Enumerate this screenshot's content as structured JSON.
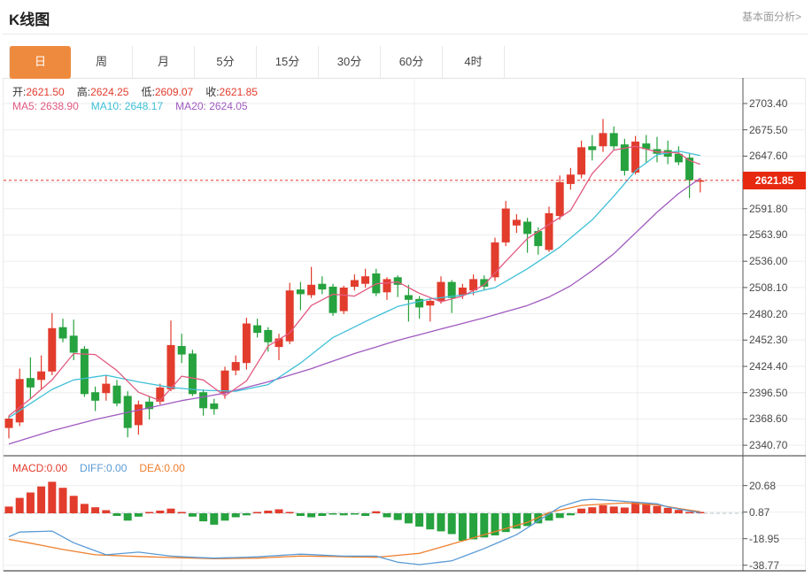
{
  "header": {
    "title": "K线图",
    "link": "基本面分析>"
  },
  "tabs": {
    "items": [
      "日",
      "周",
      "月",
      "5分",
      "15分",
      "30分",
      "60分",
      "4时"
    ],
    "active_index": 0
  },
  "info": {
    "open_label": "开:",
    "open": "2621.50",
    "high_label": "高:",
    "high": "2624.25",
    "low_label": "低:",
    "low": "2609.07",
    "close_label": "收:",
    "close": "2621.85",
    "ma5_label": "MA5:",
    "ma5": "2638.90",
    "ma10_label": "MA10:",
    "ma10": "2648.17",
    "ma20_label": "MA20:",
    "ma20": "2624.05"
  },
  "macd_legend": {
    "macd_label": "MACD:",
    "macd": "0.00",
    "diff_label": "DIFF:",
    "diff": "0.00",
    "dea_label": "DEA:",
    "dea": "0.00"
  },
  "colors": {
    "up": "#e23c2d",
    "down": "#26a23e",
    "ma5": "#e25a80",
    "ma10": "#3fc0d8",
    "ma20": "#a05ac0",
    "diff": "#5b9bd5",
    "dea": "#ee7f2d",
    "badge": "#e7290f",
    "tab_active": "#ee8a3e",
    "dotted_line": "#e8392f",
    "ohlc_value": "#e23c2d"
  },
  "chart_data": {
    "type": "candlestick",
    "title": "K线图",
    "current_price": 2621.85,
    "current_price_label": "2621.85",
    "price_axis": {
      "labels": [
        "2703.40",
        "2675.50",
        "2647.60",
        "2591.80",
        "2563.90",
        "2536.00",
        "2508.10",
        "2480.20",
        "2452.30",
        "2424.40",
        "2396.50",
        "2368.60",
        "2340.70"
      ],
      "gridlines": [
        2703.4,
        2675.5,
        2647.6,
        2619.7,
        2591.8,
        2563.9,
        2536.0,
        2508.1,
        2480.2,
        2452.3,
        2424.4,
        2396.5,
        2368.6,
        2340.7
      ]
    },
    "macd_axis": {
      "labels": [
        "20.68",
        "0.87",
        "-18.95",
        "-38.77"
      ],
      "values": [
        20.68,
        0.87,
        -18.95,
        -38.77
      ]
    },
    "candles": [
      [
        2359,
        2372,
        2348,
        2369
      ],
      [
        2365,
        2422,
        2361,
        2411
      ],
      [
        2412,
        2434,
        2390,
        2402
      ],
      [
        2410,
        2436,
        2400,
        2419
      ],
      [
        2419,
        2481,
        2415,
        2465
      ],
      [
        2466,
        2475,
        2450,
        2454
      ],
      [
        2457,
        2474,
        2431,
        2439
      ],
      [
        2443,
        2446,
        2392,
        2395
      ],
      [
        2397,
        2403,
        2377,
        2388
      ],
      [
        2396,
        2415,
        2388,
        2406
      ],
      [
        2404,
        2410,
        2382,
        2385
      ],
      [
        2393,
        2398,
        2349,
        2359
      ],
      [
        2362,
        2388,
        2352,
        2384
      ],
      [
        2387,
        2392,
        2368,
        2379
      ],
      [
        2387,
        2406,
        2384,
        2402
      ],
      [
        2400,
        2473,
        2398,
        2447
      ],
      [
        2446,
        2459,
        2428,
        2437
      ],
      [
        2438,
        2442,
        2393,
        2395
      ],
      [
        2397,
        2400,
        2372,
        2380
      ],
      [
        2385,
        2390,
        2373,
        2379
      ],
      [
        2396,
        2424,
        2390,
        2420
      ],
      [
        2420,
        2436,
        2415,
        2429
      ],
      [
        2428,
        2476,
        2421,
        2470
      ],
      [
        2468,
        2475,
        2455,
        2460
      ],
      [
        2463,
        2466,
        2440,
        2450
      ],
      [
        2445,
        2459,
        2431,
        2454
      ],
      [
        2451,
        2513,
        2448,
        2505
      ],
      [
        2506,
        2514,
        2484,
        2501
      ],
      [
        2500,
        2530,
        2497,
        2511
      ],
      [
        2512,
        2520,
        2501,
        2506
      ],
      [
        2509,
        2512,
        2478,
        2481
      ],
      [
        2483,
        2510,
        2480,
        2508
      ],
      [
        2509,
        2522,
        2505,
        2516
      ],
      [
        2512,
        2528,
        2508,
        2520
      ],
      [
        2523,
        2528,
        2499,
        2502
      ],
      [
        2503,
        2519,
        2495,
        2517
      ],
      [
        2519,
        2521,
        2498,
        2511
      ],
      [
        2500,
        2511,
        2472,
        2495
      ],
      [
        2496,
        2499,
        2475,
        2487
      ],
      [
        2489,
        2496,
        2472,
        2494
      ],
      [
        2494,
        2520,
        2491,
        2514
      ],
      [
        2514,
        2516,
        2481,
        2497
      ],
      [
        2500,
        2512,
        2496,
        2508
      ],
      [
        2505,
        2522,
        2500,
        2517
      ],
      [
        2517,
        2521,
        2505,
        2509
      ],
      [
        2519,
        2561,
        2515,
        2556
      ],
      [
        2556,
        2600,
        2552,
        2592
      ],
      [
        2574,
        2586,
        2566,
        2580
      ],
      [
        2578,
        2582,
        2545,
        2565
      ],
      [
        2568,
        2572,
        2543,
        2552
      ],
      [
        2548,
        2594,
        2546,
        2587
      ],
      [
        2584,
        2627,
        2580,
        2620
      ],
      [
        2618,
        2635,
        2612,
        2628
      ],
      [
        2628,
        2664,
        2624,
        2657
      ],
      [
        2658,
        2670,
        2643,
        2654
      ],
      [
        2658,
        2687,
        2652,
        2672
      ],
      [
        2672,
        2679,
        2654,
        2658
      ],
      [
        2660,
        2666,
        2627,
        2632
      ],
      [
        2630,
        2669,
        2628,
        2663
      ],
      [
        2661,
        2670,
        2640,
        2655
      ],
      [
        2655,
        2668,
        2641,
        2650
      ],
      [
        2654,
        2664,
        2639,
        2647
      ],
      [
        2650,
        2658,
        2638,
        2641
      ],
      [
        2646,
        2650,
        2603,
        2622
      ],
      [
        2621.5,
        2624.25,
        2609.07,
        2621.85
      ]
    ],
    "ma5_anchors": [
      [
        1,
        2372
      ],
      [
        3,
        2390
      ],
      [
        5,
        2410
      ],
      [
        7,
        2438
      ],
      [
        9,
        2437
      ],
      [
        11,
        2420
      ],
      [
        13,
        2397
      ],
      [
        15,
        2388
      ],
      [
        17,
        2414
      ],
      [
        19,
        2410
      ],
      [
        21,
        2393
      ],
      [
        23,
        2409
      ],
      [
        25,
        2446
      ],
      [
        27,
        2460
      ],
      [
        29,
        2489
      ],
      [
        31,
        2501
      ],
      [
        33,
        2499
      ],
      [
        35,
        2512
      ],
      [
        37,
        2514
      ],
      [
        39,
        2502
      ],
      [
        41,
        2493
      ],
      [
        43,
        2499
      ],
      [
        45,
        2511
      ],
      [
        47,
        2536
      ],
      [
        49,
        2560
      ],
      [
        51,
        2575
      ],
      [
        53,
        2590
      ],
      [
        55,
        2629
      ],
      [
        57,
        2654
      ],
      [
        59,
        2658
      ],
      [
        61,
        2652
      ],
      [
        63,
        2651
      ],
      [
        64,
        2643
      ],
      [
        65,
        2638.9
      ]
    ],
    "ma10_anchors": [
      [
        1,
        2370
      ],
      [
        3,
        2385
      ],
      [
        5,
        2400
      ],
      [
        7,
        2410
      ],
      [
        10,
        2415
      ],
      [
        13,
        2408
      ],
      [
        16,
        2402
      ],
      [
        19,
        2399
      ],
      [
        22,
        2398
      ],
      [
        25,
        2405
      ],
      [
        28,
        2428
      ],
      [
        31,
        2455
      ],
      [
        34,
        2472
      ],
      [
        37,
        2488
      ],
      [
        40,
        2496
      ],
      [
        43,
        2500
      ],
      [
        46,
        2508
      ],
      [
        49,
        2528
      ],
      [
        52,
        2551
      ],
      [
        55,
        2580
      ],
      [
        57,
        2605
      ],
      [
        59,
        2632
      ],
      [
        61,
        2649
      ],
      [
        63,
        2653
      ],
      [
        65,
        2648.2
      ]
    ],
    "ma20_anchors": [
      [
        1,
        2342
      ],
      [
        5,
        2356
      ],
      [
        9,
        2368
      ],
      [
        13,
        2378
      ],
      [
        17,
        2388
      ],
      [
        21,
        2396
      ],
      [
        25,
        2408
      ],
      [
        29,
        2422
      ],
      [
        33,
        2438
      ],
      [
        37,
        2452
      ],
      [
        41,
        2464
      ],
      [
        45,
        2476
      ],
      [
        49,
        2489
      ],
      [
        51,
        2498
      ],
      [
        53,
        2510
      ],
      [
        55,
        2526
      ],
      [
        57,
        2544
      ],
      [
        59,
        2566
      ],
      [
        61,
        2588
      ],
      [
        63,
        2608
      ],
      [
        65,
        2624
      ]
    ],
    "macd_histogram": [
      5,
      11.5,
      15.5,
      20,
      23.5,
      19,
      13,
      7,
      4.5,
      2.3,
      -2,
      -5.5,
      -2.5,
      0.3,
      2,
      3.5,
      1,
      -2.5,
      -6,
      -8.5,
      -5.5,
      -3,
      -1.5,
      0.3,
      2,
      3,
      0.3,
      -2,
      -3,
      -2,
      -1,
      -1.5,
      -1,
      -2,
      1.5,
      -3,
      -5,
      -7.5,
      -10,
      -12,
      -13.5,
      -15.5,
      -20.5,
      -19.5,
      -18,
      -16.5,
      -14,
      -11.5,
      -9.5,
      -7.5,
      -5.5,
      -3.5,
      -1.5,
      3.5,
      4.5,
      6,
      5,
      4.3,
      8.5,
      7.5,
      5.5,
      4,
      2.5,
      1,
      0.3
    ],
    "diff_anchors": [
      [
        1,
        -17.5
      ],
      [
        2,
        -14
      ],
      [
        5,
        -13.3
      ],
      [
        7,
        -22
      ],
      [
        10,
        -31
      ],
      [
        13,
        -29
      ],
      [
        16,
        -32
      ],
      [
        20,
        -33.5
      ],
      [
        24,
        -32.5
      ],
      [
        28,
        -30.5
      ],
      [
        32,
        -32
      ],
      [
        35,
        -32
      ],
      [
        37,
        -36.5
      ],
      [
        39,
        -38.3
      ],
      [
        42,
        -35.5
      ],
      [
        45,
        -26.3
      ],
      [
        48,
        -16
      ],
      [
        50,
        -5.7
      ],
      [
        52,
        4.7
      ],
      [
        54,
        9.8
      ],
      [
        55,
        10.5
      ],
      [
        58,
        8.9
      ],
      [
        61,
        7.1
      ],
      [
        62,
        4.7
      ],
      [
        64,
        1.7
      ],
      [
        65,
        0.6
      ]
    ],
    "dea_anchors": [
      [
        1,
        -19.5
      ],
      [
        3,
        -22.3
      ],
      [
        6,
        -27
      ],
      [
        9,
        -31
      ],
      [
        12,
        -32
      ],
      [
        16,
        -33
      ],
      [
        20,
        -33.9
      ],
      [
        24,
        -33.5
      ],
      [
        28,
        -31.9
      ],
      [
        35,
        -32.8
      ],
      [
        39,
        -29.9
      ],
      [
        42,
        -23
      ],
      [
        46,
        -13.7
      ],
      [
        49,
        -6.8
      ],
      [
        51,
        0.6
      ],
      [
        54,
        5.9
      ],
      [
        58,
        7.7
      ],
      [
        61,
        6.3
      ],
      [
        63,
        3.6
      ],
      [
        65,
        1.2
      ]
    ]
  }
}
